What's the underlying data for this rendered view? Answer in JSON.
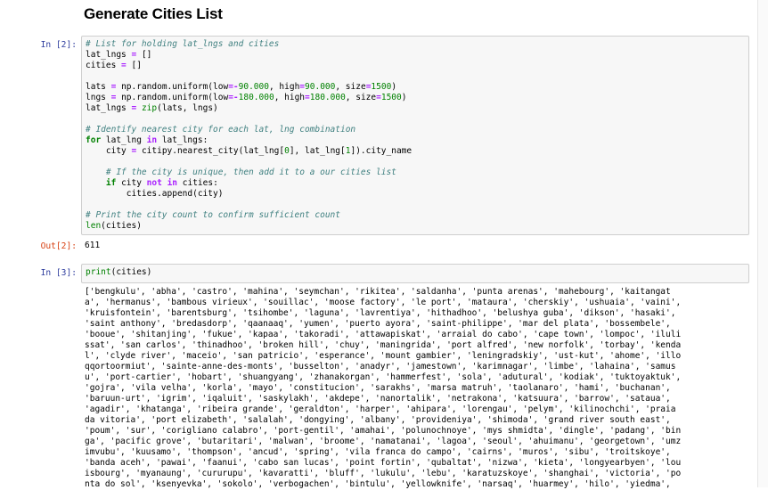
{
  "heading": "Generate Cities List",
  "cells": [
    {
      "in_prompt": "In [2]:",
      "out_prompt": "Out[2]:",
      "output": "611"
    },
    {
      "in_prompt": "In [3]:",
      "output_lines": [
        "['bengkulu', 'abha', 'castro', 'mahina', 'seymchan', 'rikitea', 'saldanha', 'punta arenas', 'mahebourg', 'kaitangat",
        "a', 'hermanus', 'bambous virieux', 'souillac', 'moose factory', 'le port', 'mataura', 'cherskiy', 'ushuaia', 'vaini',",
        "'kruisfontein', 'barentsburg', 'tsihombe', 'laguna', 'lavrentiya', 'hithadhoo', 'belushya guba', 'dikson', 'hasaki',",
        "'saint anthony', 'bredasdorp', 'qaanaaq', 'yumen', 'puerto ayora', 'saint-philippe', 'mar del plata', 'bossembele',",
        "'booue', 'shitanjing', 'fukue', 'kapaa', 'takoradi', 'attawapiskat', 'arraial do cabo', 'cape town', 'lompoc', 'iluli",
        "ssat', 'san carlos', 'thinadhoo', 'broken hill', 'chuy', 'maningrida', 'port alfred', 'new norfolk', 'torbay', 'kenda",
        "l', 'clyde river', 'maceio', 'san patricio', 'esperance', 'mount gambier', 'leningradskiy', 'ust-kut', 'ahome', 'illo",
        "qqortoormiut', 'sainte-anne-des-monts', 'busselton', 'anadyr', 'jamestown', 'karimnagar', 'limbe', 'lahaina', 'samus",
        "u', 'port-cartier', 'hobart', 'shuangyang', 'zhanakorgan', 'hammerfest', 'sola', 'adutural', 'kodiak', 'tuktoyaktuk',",
        "'gojra', 'vila velha', 'korla', 'mayo', 'constitucion', 'sarakhs', 'marsa matruh', 'taolanaro', 'hami', 'buchanan',",
        "'baruun-urt', 'igrim', 'iqaluit', 'saskylakh', 'akdepe', 'nanortalik', 'netrakona', 'katsuura', 'barrow', 'sataua',",
        "'agadir', 'khatanga', 'ribeira grande', 'geraldton', 'harper', 'ahipara', 'lorengau', 'pelym', 'kilinochchi', 'praia",
        "da vitoria', 'port elizabeth', 'salalah', 'dongying', 'albany', 'provideniya', 'shimoda', 'grand river south east',",
        "'poum', 'sur', 'corigliano calabro', 'port-gentil', 'amahai', 'polunochnoye', 'mys shmidta', 'dingle', 'padang', 'bin",
        "ga', 'pacific grove', 'butaritari', 'malwan', 'broome', 'namatanai', 'lagoa', 'seoul', 'ahuimanu', 'georgetown', 'umz",
        "imvubu', 'kuusamo', 'thompson', 'ancud', 'spring', 'vila franca do campo', 'cairns', 'muros', 'sibu', 'troitskoye',",
        "'banda aceh', 'pawai', 'faanui', 'cabo san lucas', 'point fortin', 'qubaltat', 'nizwa', 'kieta', 'longyearbyen', 'lou",
        "isbourg', 'myanaung', 'cururupu', 'kavaratti', 'bluff', 'lukulu', 'lebu', 'karatuzskoye', 'shanghai', 'victoria', 'po",
        "nta do sol', 'ksenyevka', 'sokolo', 'verbogachen', 'bintulu', 'yellowknife', 'narsaq', 'huarmey', 'hilo', 'yiedma',"
      ]
    }
  ]
}
